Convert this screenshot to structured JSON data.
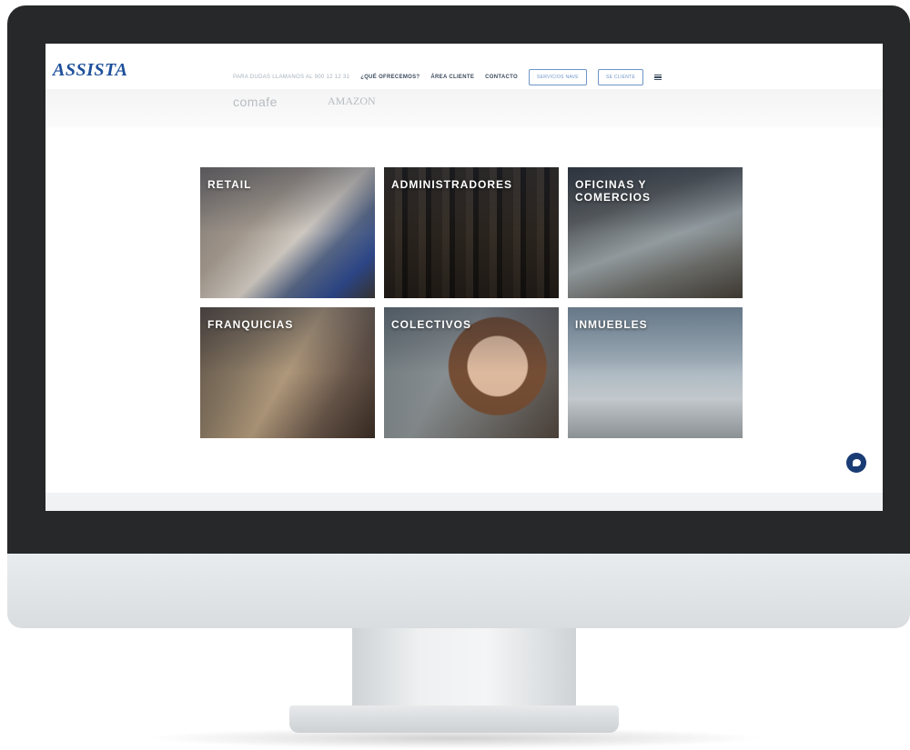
{
  "header": {
    "logo": "ASSISTA",
    "logo_subtitle": "",
    "phone": "PARA DUDAS LLAMANOS AL 900 12 12 31",
    "nav_links": [
      "¿QUÉ OFRECEMOS?",
      "ÁREA CLIENTE",
      "CONTACTO"
    ],
    "buttons": [
      "SERVICIOS NAVE",
      "SE CLIENTE"
    ]
  },
  "brands": [
    "comafe",
    "AMAZON",
    "",
    "",
    ""
  ],
  "categories": [
    {
      "label": "RETAIL"
    },
    {
      "label": "ADMINISTRADORES"
    },
    {
      "label": "OFICINAS Y COMERCIOS"
    },
    {
      "label": "FRANQUICIAS"
    },
    {
      "label": "COLECTIVOS"
    },
    {
      "label": "INMUEBLES"
    }
  ],
  "colors": {
    "brand_blue": "#1d4f9a",
    "chat_button": "#1a3c74",
    "bezel": "#262829"
  },
  "icons": {
    "menu": "hamburger-icon",
    "chat": "chat-bubble-icon"
  }
}
